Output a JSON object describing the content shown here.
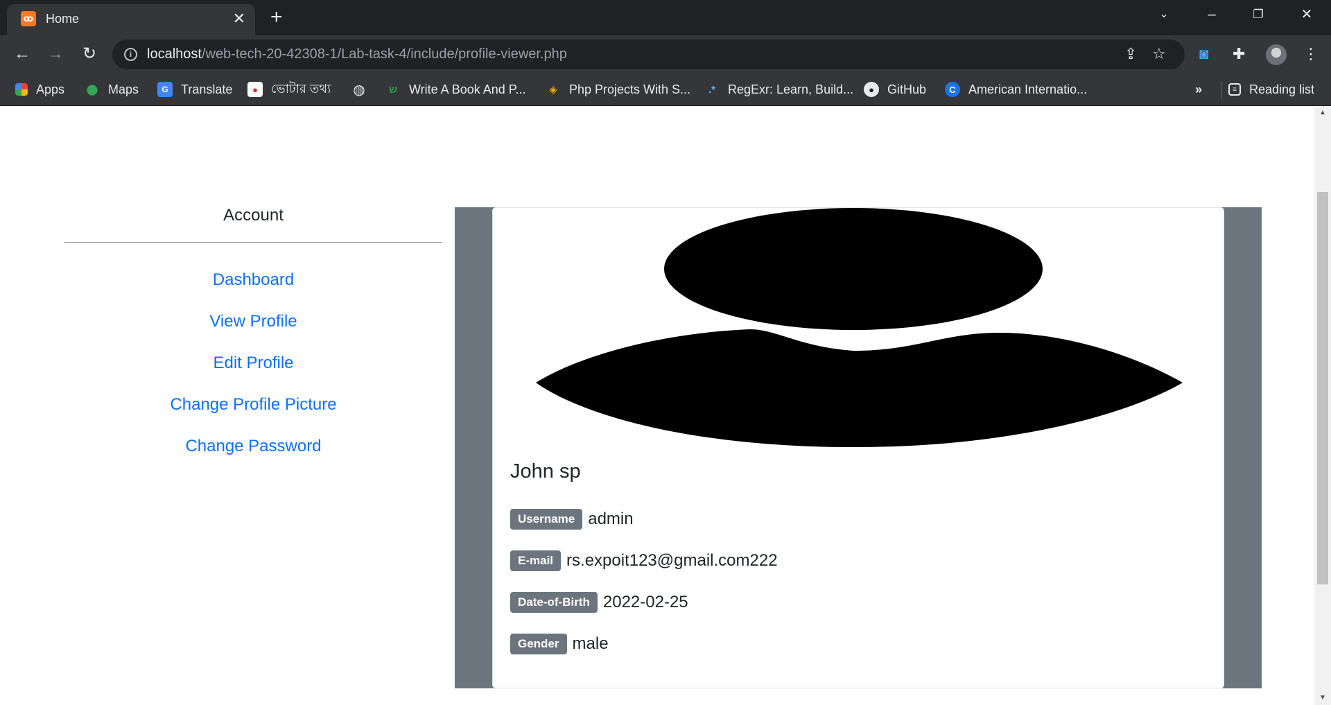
{
  "browser": {
    "tab_title": "Home",
    "tab_close": "✕",
    "new_tab": "+",
    "url_host": "localhost",
    "url_path": "/web-tech-20-42308-1/Lab-task-4/include/profile-viewer.php",
    "bookmarks": [
      {
        "label": "Apps",
        "icon": "apps-grid-icon"
      },
      {
        "label": "Maps",
        "icon": "maps-pin-icon"
      },
      {
        "label": "Translate",
        "icon": "translate-icon"
      },
      {
        "label": "ভোটার তথ্য",
        "icon": "voter-info-icon"
      },
      {
        "label": "",
        "icon": "globe-icon"
      },
      {
        "label": "Write A Book And P...",
        "icon": "book-site-icon"
      },
      {
        "label": "Php Projects With S...",
        "icon": "php-projects-icon"
      },
      {
        "label": "RegExr: Learn, Build...",
        "icon": "regexr-icon"
      },
      {
        "label": "GitHub",
        "icon": "github-icon"
      },
      {
        "label": "American Internatio...",
        "icon": "aiub-icon"
      }
    ],
    "bookmarks_overflow": "»",
    "reading_list": "Reading list",
    "colors": {
      "titlebar": "#202124",
      "toolbar": "#35363a",
      "omnibox": "#202124"
    }
  },
  "sidebar": {
    "title": "Account",
    "links": [
      {
        "label": "Dashboard"
      },
      {
        "label": "View Profile"
      },
      {
        "label": "Edit Profile"
      },
      {
        "label": "Change Profile Picture"
      },
      {
        "label": "Change Password"
      }
    ],
    "link_color": "#0d6efd"
  },
  "profile": {
    "name": "John sp",
    "fields": [
      {
        "label": "Username",
        "value": "admin"
      },
      {
        "label": "E-mail",
        "value": "rs.expoit123@gmail.com222"
      },
      {
        "label": "Date-of-Birth",
        "value": "2022-02-25"
      },
      {
        "label": "Gender",
        "value": "male"
      }
    ],
    "badge_color": "#6c757d",
    "panel_color": "#6c757d"
  }
}
